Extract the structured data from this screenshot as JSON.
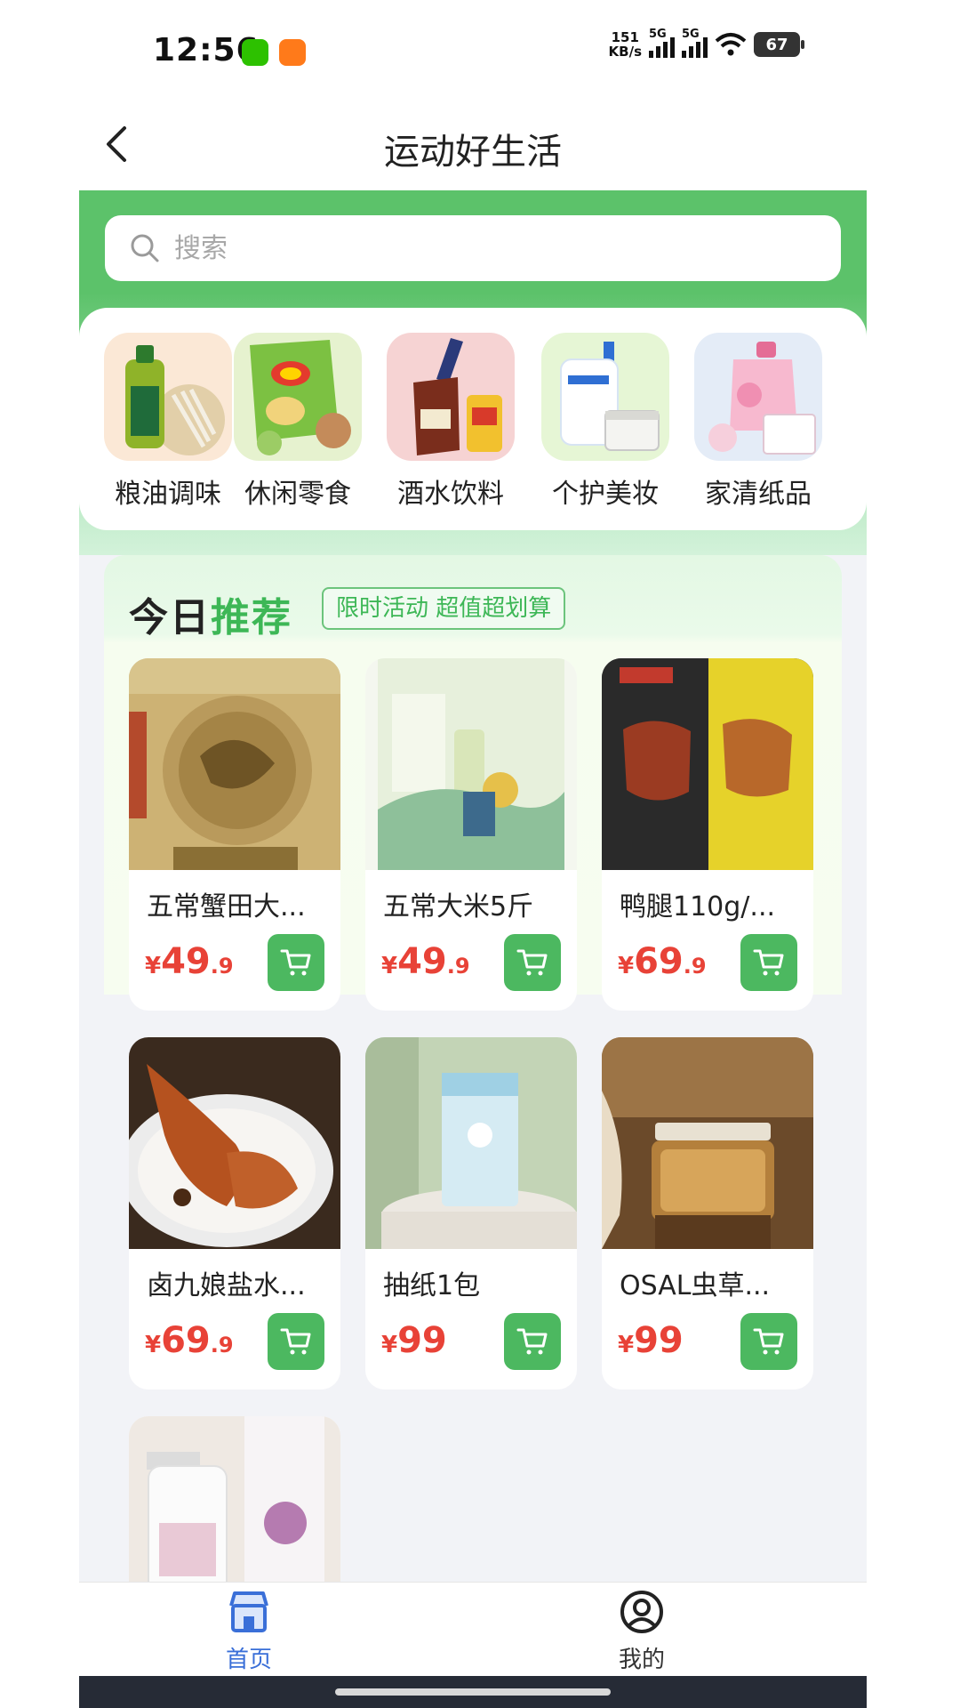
{
  "status_bar": {
    "time": "12:56",
    "net_speed_value": "151",
    "net_speed_unit": "KB/s",
    "signal_label_1": "5G",
    "signal_label_2": "5G",
    "battery": "67"
  },
  "header": {
    "title": "运动好生活"
  },
  "search": {
    "placeholder": "搜索"
  },
  "categories": [
    {
      "label": "粮油调味",
      "icon": "cooking-oil-icon"
    },
    {
      "label": "休闲零食",
      "icon": "snack-chips-icon"
    },
    {
      "label": "酒水饮料",
      "icon": "liquor-drink-icon"
    },
    {
      "label": "个护美妆",
      "icon": "skincare-icon"
    },
    {
      "label": "家清纸品",
      "icon": "household-cleaning-icon"
    }
  ],
  "recommend": {
    "title_plain": "今日",
    "title_accent": "推荐",
    "tag": "限时活动 超值超划算"
  },
  "products": [
    {
      "name": "五常蟹田大...",
      "yen": "¥",
      "price_int": "49",
      "price_dec": ".9"
    },
    {
      "name": "五常大米5斤",
      "yen": "¥",
      "price_int": "49",
      "price_dec": ".9"
    },
    {
      "name": "鸭腿110g/...",
      "yen": "¥",
      "price_int": "69",
      "price_dec": ".9"
    },
    {
      "name": "卤九娘盐水...",
      "yen": "¥",
      "price_int": "69",
      "price_dec": ".9"
    },
    {
      "name": "抽纸1包",
      "yen": "¥",
      "price_int": "99",
      "price_dec": ""
    },
    {
      "name": "OSAL虫草...",
      "yen": "¥",
      "price_int": "99",
      "price_dec": ""
    }
  ],
  "bottom_nav": {
    "home": "首页",
    "mine": "我的"
  },
  "colors": {
    "brand_green": "#4cb860",
    "price_red": "#e84237",
    "nav_active_blue": "#3a6fd8"
  }
}
